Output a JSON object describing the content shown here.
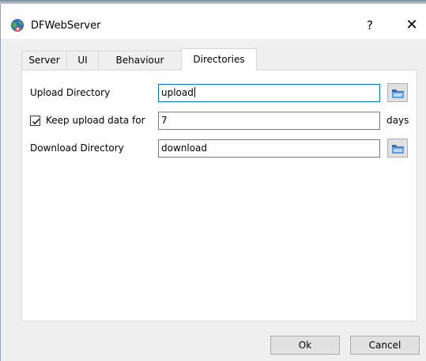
{
  "window": {
    "title": "DFWebServer",
    "help_label": "?",
    "close_label": "✕"
  },
  "tabs": [
    {
      "label": "Server",
      "active": false
    },
    {
      "label": "UI",
      "active": false
    },
    {
      "label": "Behaviour",
      "active": false
    },
    {
      "label": "Directories",
      "active": true
    }
  ],
  "directories": {
    "upload_label": "Upload Directory",
    "upload_value": "upload",
    "keep_checkbox_checked": true,
    "keep_label": "Keep upload data for",
    "keep_value": "7",
    "keep_unit": "days",
    "download_label": "Download Directory",
    "download_value": "download"
  },
  "buttons": {
    "ok": "Ok",
    "cancel": "Cancel"
  },
  "icons": {
    "app": "globe-shield-icon",
    "browse": "folder-icon",
    "check": "checkmark-icon"
  },
  "colors": {
    "focus_border": "#0078d7",
    "dialog_bg": "#f0f0f0"
  }
}
